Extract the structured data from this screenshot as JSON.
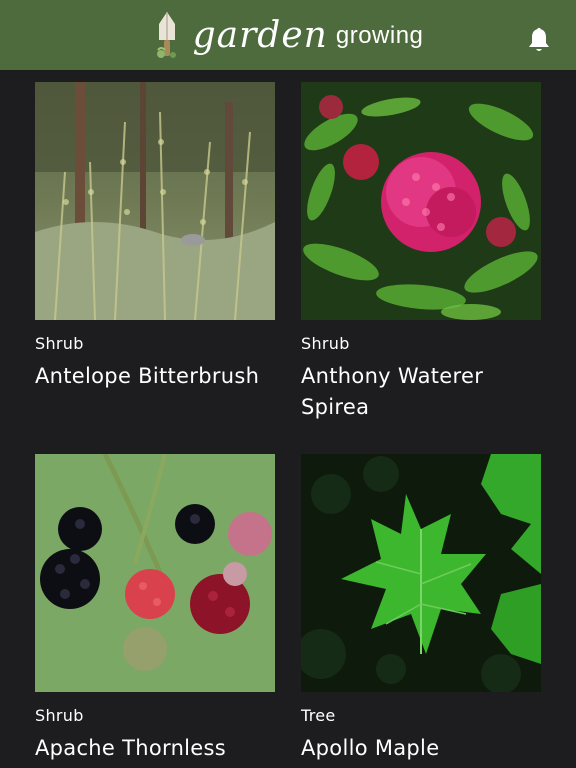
{
  "header": {
    "logo_script": "garden",
    "logo_word": "growing",
    "icons": {
      "logo": "trowel-logo-icon",
      "notifications": "bell-icon"
    }
  },
  "plants": [
    {
      "category": "Shrub",
      "name": "Antelope Bitterbrush",
      "photo": "bitterbrush-photo"
    },
    {
      "category": "Shrub",
      "name": "Anthony Waterer Spirea",
      "photo": "spirea-photo"
    },
    {
      "category": "Shrub",
      "name": "Apache Thornless",
      "photo": "blackberry-photo"
    },
    {
      "category": "Tree",
      "name": "Apollo Maple",
      "photo": "maple-photo"
    }
  ],
  "colors": {
    "header_bg": "#4d6b3c",
    "page_bg": "#1d1c1f",
    "text": "#ffffff"
  }
}
